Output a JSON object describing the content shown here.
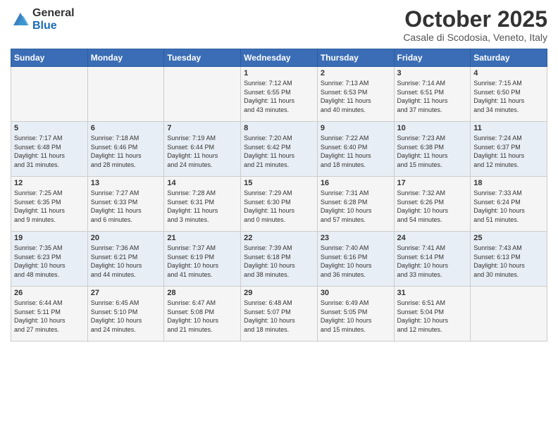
{
  "logo": {
    "general": "General",
    "blue": "Blue"
  },
  "header": {
    "month": "October 2025",
    "location": "Casale di Scodosia, Veneto, Italy"
  },
  "days_of_week": [
    "Sunday",
    "Monday",
    "Tuesday",
    "Wednesday",
    "Thursday",
    "Friday",
    "Saturday"
  ],
  "weeks": [
    [
      {
        "num": "",
        "info": ""
      },
      {
        "num": "",
        "info": ""
      },
      {
        "num": "",
        "info": ""
      },
      {
        "num": "1",
        "info": "Sunrise: 7:12 AM\nSunset: 6:55 PM\nDaylight: 11 hours\nand 43 minutes."
      },
      {
        "num": "2",
        "info": "Sunrise: 7:13 AM\nSunset: 6:53 PM\nDaylight: 11 hours\nand 40 minutes."
      },
      {
        "num": "3",
        "info": "Sunrise: 7:14 AM\nSunset: 6:51 PM\nDaylight: 11 hours\nand 37 minutes."
      },
      {
        "num": "4",
        "info": "Sunrise: 7:15 AM\nSunset: 6:50 PM\nDaylight: 11 hours\nand 34 minutes."
      }
    ],
    [
      {
        "num": "5",
        "info": "Sunrise: 7:17 AM\nSunset: 6:48 PM\nDaylight: 11 hours\nand 31 minutes."
      },
      {
        "num": "6",
        "info": "Sunrise: 7:18 AM\nSunset: 6:46 PM\nDaylight: 11 hours\nand 28 minutes."
      },
      {
        "num": "7",
        "info": "Sunrise: 7:19 AM\nSunset: 6:44 PM\nDaylight: 11 hours\nand 24 minutes."
      },
      {
        "num": "8",
        "info": "Sunrise: 7:20 AM\nSunset: 6:42 PM\nDaylight: 11 hours\nand 21 minutes."
      },
      {
        "num": "9",
        "info": "Sunrise: 7:22 AM\nSunset: 6:40 PM\nDaylight: 11 hours\nand 18 minutes."
      },
      {
        "num": "10",
        "info": "Sunrise: 7:23 AM\nSunset: 6:38 PM\nDaylight: 11 hours\nand 15 minutes."
      },
      {
        "num": "11",
        "info": "Sunrise: 7:24 AM\nSunset: 6:37 PM\nDaylight: 11 hours\nand 12 minutes."
      }
    ],
    [
      {
        "num": "12",
        "info": "Sunrise: 7:25 AM\nSunset: 6:35 PM\nDaylight: 11 hours\nand 9 minutes."
      },
      {
        "num": "13",
        "info": "Sunrise: 7:27 AM\nSunset: 6:33 PM\nDaylight: 11 hours\nand 6 minutes."
      },
      {
        "num": "14",
        "info": "Sunrise: 7:28 AM\nSunset: 6:31 PM\nDaylight: 11 hours\nand 3 minutes."
      },
      {
        "num": "15",
        "info": "Sunrise: 7:29 AM\nSunset: 6:30 PM\nDaylight: 11 hours\nand 0 minutes."
      },
      {
        "num": "16",
        "info": "Sunrise: 7:31 AM\nSunset: 6:28 PM\nDaylight: 10 hours\nand 57 minutes."
      },
      {
        "num": "17",
        "info": "Sunrise: 7:32 AM\nSunset: 6:26 PM\nDaylight: 10 hours\nand 54 minutes."
      },
      {
        "num": "18",
        "info": "Sunrise: 7:33 AM\nSunset: 6:24 PM\nDaylight: 10 hours\nand 51 minutes."
      }
    ],
    [
      {
        "num": "19",
        "info": "Sunrise: 7:35 AM\nSunset: 6:23 PM\nDaylight: 10 hours\nand 48 minutes."
      },
      {
        "num": "20",
        "info": "Sunrise: 7:36 AM\nSunset: 6:21 PM\nDaylight: 10 hours\nand 44 minutes."
      },
      {
        "num": "21",
        "info": "Sunrise: 7:37 AM\nSunset: 6:19 PM\nDaylight: 10 hours\nand 41 minutes."
      },
      {
        "num": "22",
        "info": "Sunrise: 7:39 AM\nSunset: 6:18 PM\nDaylight: 10 hours\nand 38 minutes."
      },
      {
        "num": "23",
        "info": "Sunrise: 7:40 AM\nSunset: 6:16 PM\nDaylight: 10 hours\nand 36 minutes."
      },
      {
        "num": "24",
        "info": "Sunrise: 7:41 AM\nSunset: 6:14 PM\nDaylight: 10 hours\nand 33 minutes."
      },
      {
        "num": "25",
        "info": "Sunrise: 7:43 AM\nSunset: 6:13 PM\nDaylight: 10 hours\nand 30 minutes."
      }
    ],
    [
      {
        "num": "26",
        "info": "Sunrise: 6:44 AM\nSunset: 5:11 PM\nDaylight: 10 hours\nand 27 minutes."
      },
      {
        "num": "27",
        "info": "Sunrise: 6:45 AM\nSunset: 5:10 PM\nDaylight: 10 hours\nand 24 minutes."
      },
      {
        "num": "28",
        "info": "Sunrise: 6:47 AM\nSunset: 5:08 PM\nDaylight: 10 hours\nand 21 minutes."
      },
      {
        "num": "29",
        "info": "Sunrise: 6:48 AM\nSunset: 5:07 PM\nDaylight: 10 hours\nand 18 minutes."
      },
      {
        "num": "30",
        "info": "Sunrise: 6:49 AM\nSunset: 5:05 PM\nDaylight: 10 hours\nand 15 minutes."
      },
      {
        "num": "31",
        "info": "Sunrise: 6:51 AM\nSunset: 5:04 PM\nDaylight: 10 hours\nand 12 minutes."
      },
      {
        "num": "",
        "info": ""
      }
    ]
  ]
}
